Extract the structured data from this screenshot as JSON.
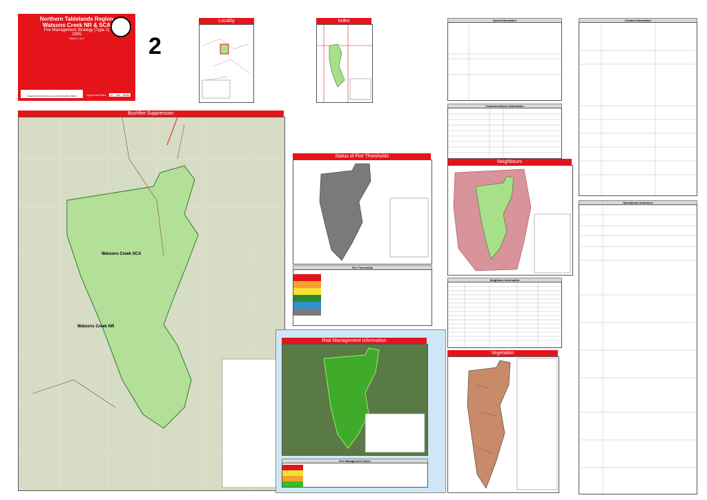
{
  "title_block": {
    "region": "Northern Tablelands Region",
    "reserve": "Watsons Creek NR & SCA",
    "strategy": "Fire Management Strategy (Type 2)",
    "year": "2005",
    "sheet": "Sheet 1 of 1",
    "map_number": "2",
    "approved_label": "Approved Date:",
    "approved_date": "27 - Oct - 2005",
    "dept": "Department of Environment and Conservation (NSW)"
  },
  "panels": {
    "bushfire": "Bushfire Suppression",
    "locality": "Locality",
    "index": "Index",
    "thresholds": "Status of Fire Thresholds",
    "neighbours": "Neighbours",
    "risk": "Risk Management Information",
    "vegetation": "Vegetation"
  },
  "map_labels": {
    "sca": "Watsons Creek SCA",
    "nr": "Watsons Creek NR"
  },
  "right_headers": {
    "asset_info": "Asset Information",
    "comm_info": "Communications Information",
    "contact_info": "Contact Information",
    "op_guidelines": "Operational Guidelines",
    "neighbour_info": "Neighbour Information",
    "fire_thresholds": "Fire Thresholds",
    "mgmt_zones": "Fire Management Zones"
  },
  "colors": {
    "red": "#e5141b",
    "reserve_green": "#a8e08a",
    "neighbour_pink": "#d9939a",
    "threshold_grey": "#7a7a7a",
    "veg_brown": "#c98a6a",
    "topo": "#d7dcc4"
  }
}
